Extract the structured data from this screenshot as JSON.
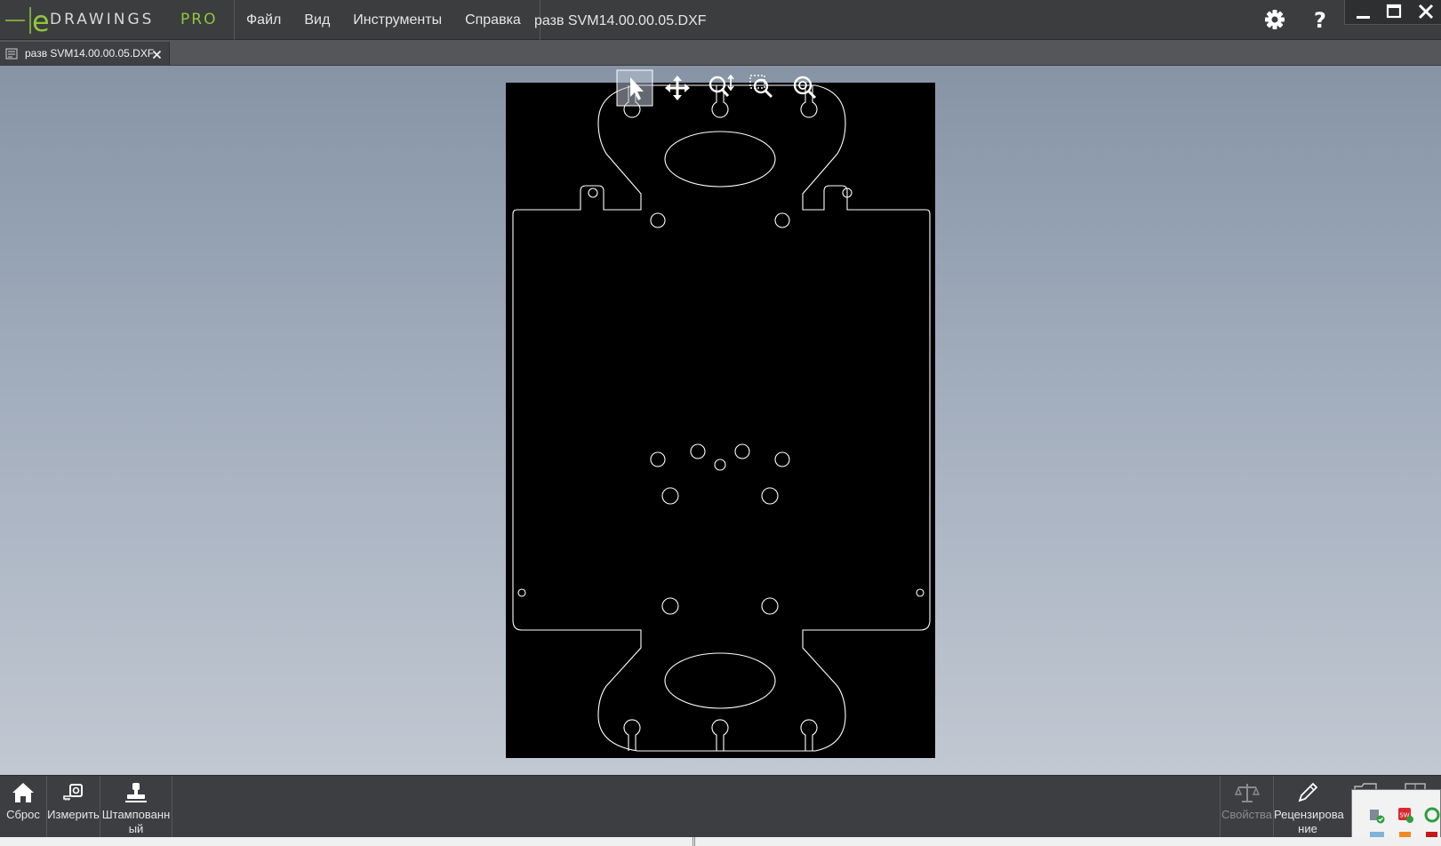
{
  "app": {
    "logo_text": "DRAWINGS",
    "logo_suffix": "PRO",
    "document_title": "разв SVM14.00.00.05.DXF"
  },
  "menu": {
    "items": [
      {
        "label": "Файл"
      },
      {
        "label": "Вид"
      },
      {
        "label": "Инструменты"
      },
      {
        "label": "Справка"
      }
    ]
  },
  "tabs": [
    {
      "label": "разв SVM14.00.00.05.DXF",
      "active": true
    }
  ],
  "view_toolbar": {
    "tools": [
      "select",
      "pan",
      "zoom-to-fit",
      "zoom-to-area",
      "zoom"
    ]
  },
  "bottom_toolbar": {
    "reset_label": "Сброс",
    "measure_label": "Измерить",
    "stamp_label_1": "Штампованн",
    "stamp_label_2": "ый",
    "properties_label": "Свойства",
    "review_label_1": "Рецензирова",
    "review_label_2": "ние"
  },
  "colors": {
    "titlebar": "#3c3d3f",
    "tabstrip": "#55565a",
    "accent": "#8ec63f",
    "sheet": "#000000",
    "outline": "#ffffff"
  }
}
